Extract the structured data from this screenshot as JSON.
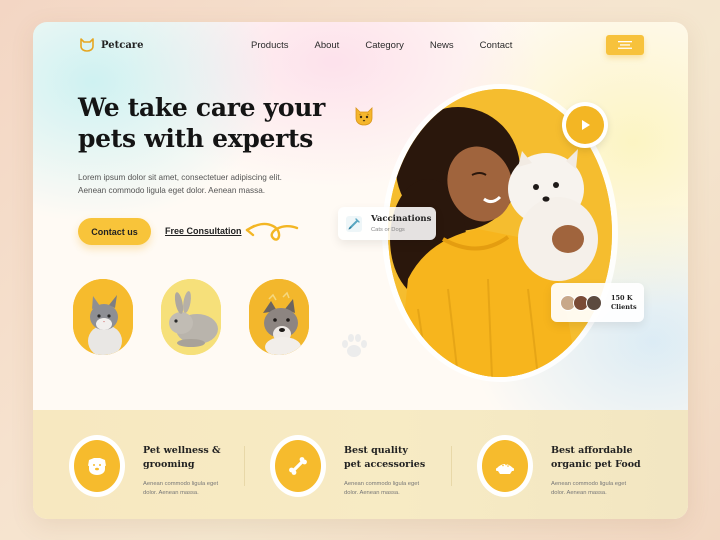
{
  "nav": {
    "logo_text": "Petcare",
    "items": [
      {
        "label": "Products"
      },
      {
        "label": "About"
      },
      {
        "label": "Category"
      },
      {
        "label": "News"
      },
      {
        "label": "Contact"
      }
    ]
  },
  "hero": {
    "headline_line1": "We take care your",
    "headline_line2": "pets with experts",
    "description_line1": "Lorem ipsum dolor sit amet, consectetuer adipiscing elit.",
    "description_line2": "Aenean commodo ligula eget dolor. Aenean massa.",
    "contact_button": "Contact us",
    "consultation_link": "Free Consultation"
  },
  "badges": {
    "vaccinations_title": "Vaccinations",
    "vaccinations_sub": "Cats or Dogs",
    "clients_line1": "150 K",
    "clients_line2": "Clients"
  },
  "features": [
    {
      "title_line1": "Pet wellness &",
      "title_line2": "grooming",
      "desc_line1": "Aenean commodo ligula eget",
      "desc_line2": "dolor. Aenean massa.",
      "icon": "dog-face-icon"
    },
    {
      "title_line1": "Best quality",
      "title_line2": "pet accessories",
      "desc_line1": "Aenean commodo ligula eget",
      "desc_line2": "dolor. Aenean massa.",
      "icon": "bone-icon"
    },
    {
      "title_line1": "Best affordable",
      "title_line2": "organic pet Food",
      "desc_line1": "Aenean commodo ligula eget",
      "desc_line2": "dolor. Aenean massa.",
      "icon": "food-bowl-icon"
    }
  ],
  "colors": {
    "accent": "#f6bb2d",
    "band": "#f7e8c0",
    "text_dark": "#141414"
  }
}
